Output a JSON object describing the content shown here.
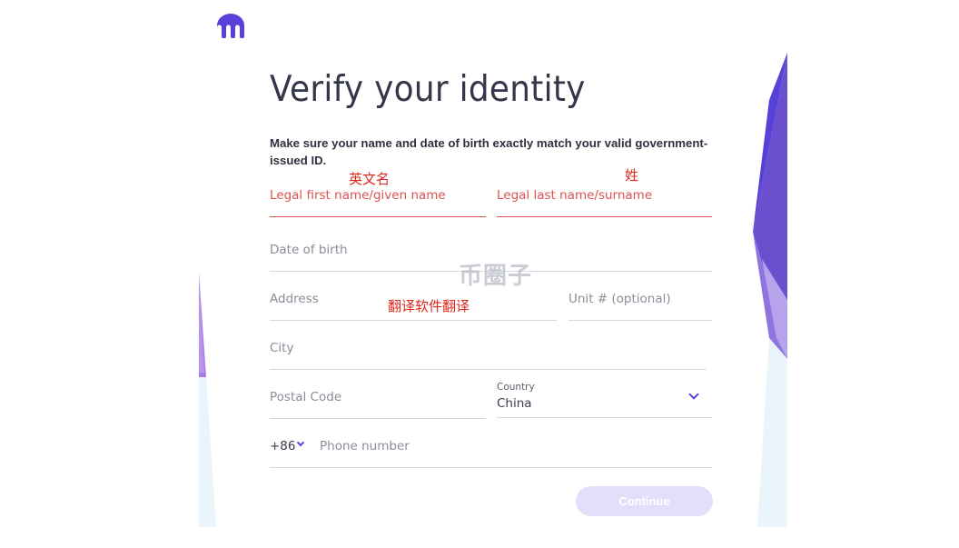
{
  "colors": {
    "brand": "#5741d9",
    "error": "#d9534f",
    "annotation": "#e1251b",
    "button_disabled": "#e3dffa"
  },
  "logo": {
    "icon": "kraken-logo-icon"
  },
  "header": {
    "title": "Verify your identity",
    "subtitle": "Make sure your name and date of birth exactly match your valid government-issued ID."
  },
  "form": {
    "first_name": {
      "label": "Legal first name/given name",
      "annotation": "英文名"
    },
    "last_name": {
      "label": "Legal last name/surname",
      "annotation": "姓"
    },
    "dob": {
      "label": "Date of birth"
    },
    "address": {
      "label": "Address",
      "annotation": "翻译软件翻译"
    },
    "unit": {
      "label": "Unit # (optional)"
    },
    "city": {
      "label": "City"
    },
    "postal": {
      "label": "Postal Code"
    },
    "country": {
      "label": "Country",
      "value": "China"
    },
    "phone": {
      "code": "+86",
      "placeholder": "Phone number"
    }
  },
  "actions": {
    "continue_label": "Continue"
  },
  "watermark": {
    "text": "币圈子"
  }
}
